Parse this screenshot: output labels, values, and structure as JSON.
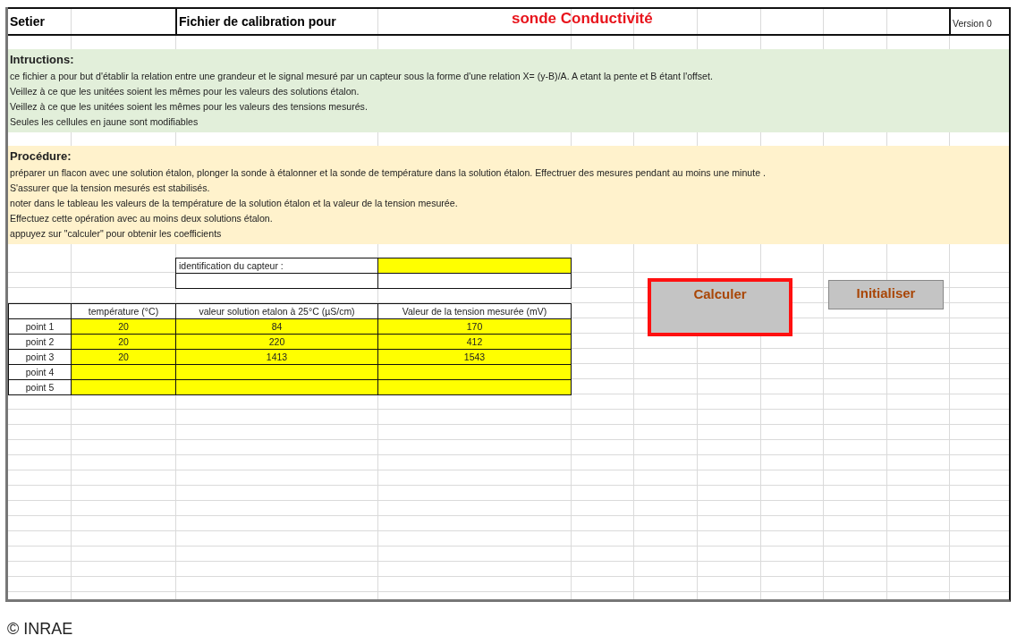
{
  "header": {
    "author": "Setier",
    "title": "Fichier de calibration pour",
    "subject": "sonde Conductivité",
    "version": "Version 0"
  },
  "instructions": {
    "heading": "Intructions:",
    "lines": [
      "ce fichier a pour but d'établir la relation entre une grandeur et le signal mesuré par un capteur sous la forme d'une relation X= (y-B)/A.    A etant la pente et B étant l'offset.",
      "Veillez à ce que les unitées soient les mêmes pour les valeurs des solutions étalon.",
      "Veillez à ce que les unitées soient les mêmes pour les valeurs des tensions mesurés.",
      "Seules les cellules en jaune sont modifiables"
    ]
  },
  "procedure": {
    "heading": "Procédure:",
    "lines": [
      "préparer un flacon avec une solution étalon, plonger la sonde à étalonner et la sonde de température dans la solution étalon. Effectruer des mesures pendant au moins une minute .",
      "S'assurer que la tension mesurés est stabilisés.",
      "noter dans le tableau les valeurs de la température de la solution étalon et la valeur de la tension mesurée.",
      "Effectuez cette opération avec au moins deux solutions étalon.",
      "appuyez sur \"calculer\" pour obtenir les coefficients"
    ]
  },
  "sensor_id": {
    "label": "identification du capteur :"
  },
  "table": {
    "columns": [
      "température (°C)",
      "valeur solution etalon à 25°C (µS/cm)",
      "Valeur de la tension mesurée (mV)"
    ],
    "rows": [
      {
        "label": "point 1",
        "cells": [
          "20",
          "84",
          "170"
        ]
      },
      {
        "label": "point 2",
        "cells": [
          "20",
          "220",
          "412"
        ]
      },
      {
        "label": "point 3",
        "cells": [
          "20",
          "1413",
          "1543"
        ]
      },
      {
        "label": "point 4",
        "cells": []
      },
      {
        "label": "point 5",
        "cells": []
      }
    ]
  },
  "buttons": [
    {
      "label": "Calculer",
      "selected": true
    },
    {
      "label": "Initialiser",
      "selected": false
    }
  ],
  "caption": "© INRAE"
}
